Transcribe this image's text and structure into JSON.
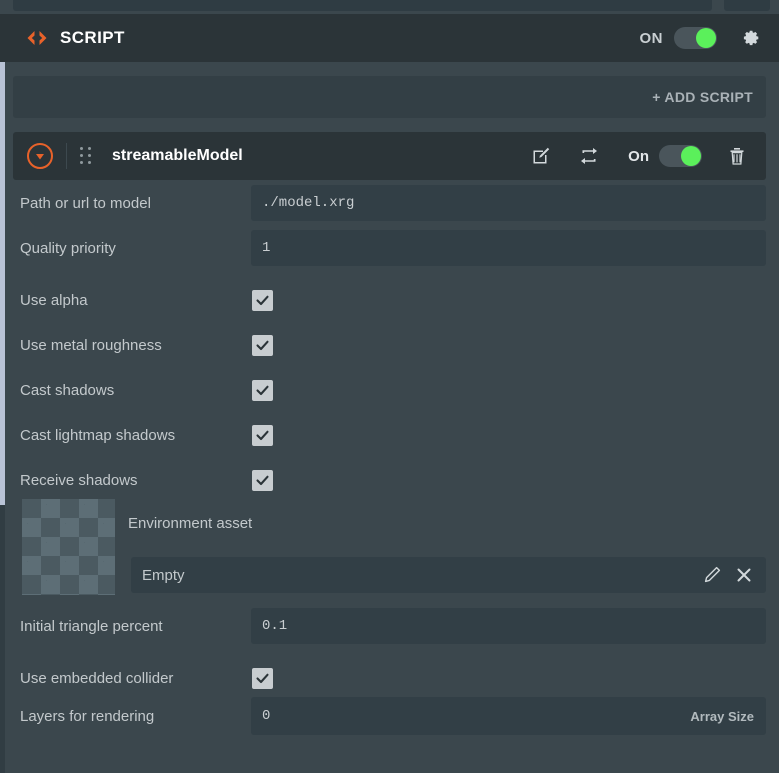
{
  "header": {
    "title": "SCRIPT",
    "code_icon": "code-brackets-icon",
    "toggle_label": "ON",
    "toggle_state": "on",
    "gear_icon": "gear-icon",
    "accent_color": "#e8622a",
    "toggle_on_color": "#5bf05b"
  },
  "add_script": {
    "label": "+ ADD SCRIPT"
  },
  "script_row": {
    "collapse_icon": "chevron-down-circle-icon",
    "drag_handle_icon": "drag-handle-icon",
    "name": "streamableModel",
    "edit_icon": "edit-square-icon",
    "reload_icon": "loop-arrows-icon",
    "toggle_label": "On",
    "toggle_state": "on",
    "delete_icon": "trash-icon"
  },
  "properties": [
    {
      "label": "Path or url to model",
      "type": "text",
      "value": "./model.xrg"
    },
    {
      "label": "Quality priority",
      "type": "text",
      "value": "1"
    },
    {
      "label": "Use alpha",
      "type": "checkbox",
      "checked": true
    },
    {
      "label": "Use metal roughness",
      "type": "checkbox",
      "checked": true
    },
    {
      "label": "Cast shadows",
      "type": "checkbox",
      "checked": true
    },
    {
      "label": "Cast lightmap shadows",
      "type": "checkbox",
      "checked": true
    },
    {
      "label": "Receive shadows",
      "type": "checkbox",
      "checked": true
    }
  ],
  "environment_asset": {
    "label": "Environment asset",
    "thumbnail": "checkerboard-empty-texture",
    "value": "Empty",
    "edit_icon": "pencil-icon",
    "clear_icon": "close-x-icon"
  },
  "properties_bottom": [
    {
      "label": "Initial triangle percent",
      "type": "text",
      "value": "0.1"
    },
    {
      "label": "Use embedded collider",
      "type": "checkbox",
      "checked": true
    },
    {
      "label": "Layers for rendering",
      "type": "text",
      "value": "0",
      "suffix": "Array Size"
    }
  ]
}
